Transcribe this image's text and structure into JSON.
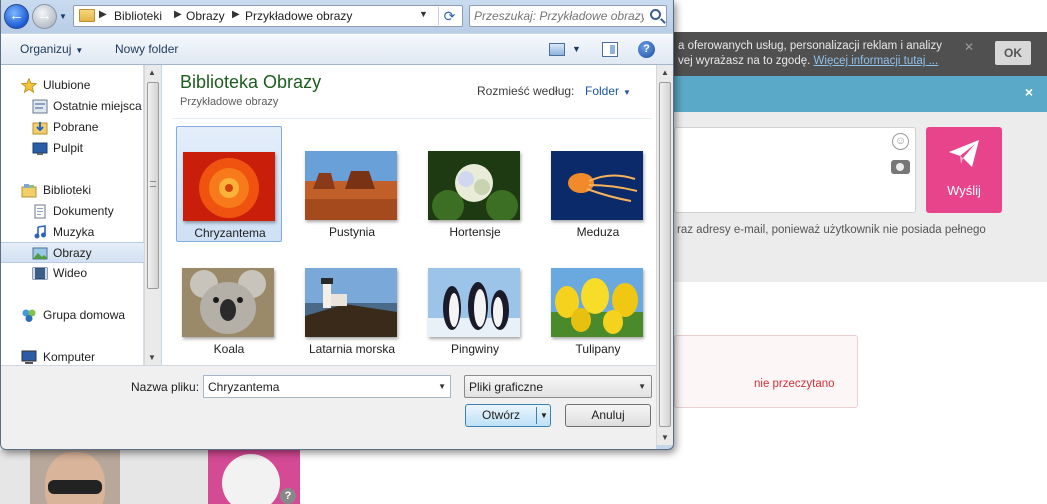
{
  "background_page": {
    "cookie_text": "a oferowanych usług, personalizacji reklam i analizy ",
    "cookie_text2": "vej wyrażasz na to zgodę.",
    "cookie_link": "Więcej informacji tutaj ...",
    "cookie_ok": "OK",
    "band_close": "×",
    "send_label": "Wyślij",
    "info_text": "raz adresy e-mail, ponieważ użytkownik nie posiada pełnego",
    "unread_label": "nie przeczytano",
    "colors": {
      "accent_pink": "#e8448c",
      "band_blue": "#5aa9c8",
      "unread_red": "#d0303c"
    }
  },
  "dialog": {
    "address": {
      "crumbs": [
        "Biblioteki",
        "Obrazy",
        "Przykładowe obrazy"
      ]
    },
    "search": {
      "placeholder": "Przeszukaj: Przykładowe obrazy"
    },
    "toolbar": {
      "organize": "Organizuj",
      "new_folder": "Nowy folder"
    },
    "nav": {
      "favorites": "Ulubione",
      "recent": "Ostatnie miejsca",
      "downloads": "Pobrane",
      "desktop": "Pulpit",
      "libraries": "Biblioteki",
      "documents": "Dokumenty",
      "music": "Muzyka",
      "pictures": "Obrazy",
      "videos": "Wideo",
      "homegroup": "Grupa domowa",
      "computer": "Komputer"
    },
    "content": {
      "title": "Biblioteka Obrazy",
      "subtitle": "Przykładowe obrazy",
      "arrange_label": "Rozmieść według:",
      "arrange_value": "Folder",
      "items": [
        {
          "label": "Chryzantema",
          "selected": true
        },
        {
          "label": "Pustynia",
          "selected": false
        },
        {
          "label": "Hortensje",
          "selected": false
        },
        {
          "label": "Meduza",
          "selected": false
        },
        {
          "label": "Koala",
          "selected": false
        },
        {
          "label": "Latarnia morska",
          "selected": false
        },
        {
          "label": "Pingwiny",
          "selected": false
        },
        {
          "label": "Tulipany",
          "selected": false
        }
      ]
    },
    "footer": {
      "filename_label": "Nazwa pliku:",
      "filename_value": "Chryzantema",
      "filter_value": "Pliki graficzne",
      "open_button": "Otwórz",
      "cancel_button": "Anuluj"
    }
  }
}
